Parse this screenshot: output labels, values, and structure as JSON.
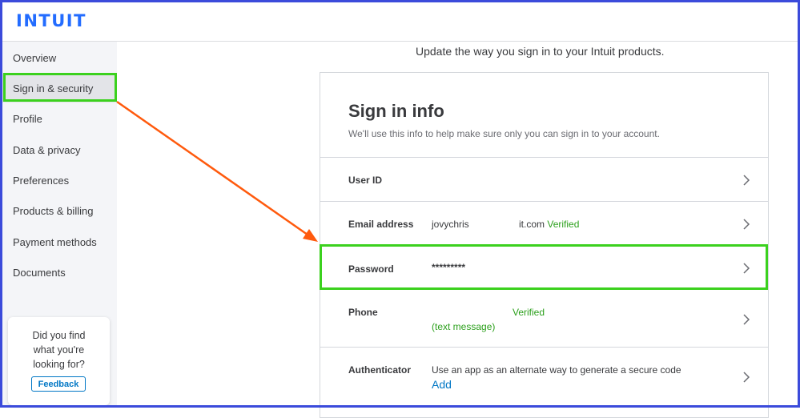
{
  "brand": {
    "logo_text": "INTUIT",
    "logo_color": "#236cff"
  },
  "sidebar": {
    "items": [
      {
        "label": "Overview"
      },
      {
        "label": "Sign in & security",
        "active": true
      },
      {
        "label": "Profile"
      },
      {
        "label": "Data & privacy"
      },
      {
        "label": "Preferences"
      },
      {
        "label": "Products & billing"
      },
      {
        "label": "Payment methods"
      },
      {
        "label": "Documents"
      }
    ],
    "feedback": {
      "line1": "Did you find",
      "line2": "what you're",
      "line3": "looking for?",
      "button_label": "Feedback"
    }
  },
  "main": {
    "subtitle": "Update the way you sign in to your Intuit products.",
    "card": {
      "title": "Sign in info",
      "description": "We'll use this info to help make sure only you can sign in to your account.",
      "rows": [
        {
          "label": "User ID"
        },
        {
          "label": "Email address",
          "value_prefix": "jovychris",
          "value_suffix": "it.com",
          "status": "Verified"
        },
        {
          "label": "Password",
          "value": "*********"
        },
        {
          "label": "Phone",
          "status": "Verified",
          "note": "(text message)"
        },
        {
          "label": "Authenticator",
          "value": "Use an app as an alternate way to generate a secure code",
          "link": "Add"
        }
      ]
    }
  },
  "annotations": {
    "highlight_color": "#3bd11e",
    "arrow_color": "#ff5a0d"
  },
  "icons": {
    "row_chevron": "chevron-right-icon"
  }
}
